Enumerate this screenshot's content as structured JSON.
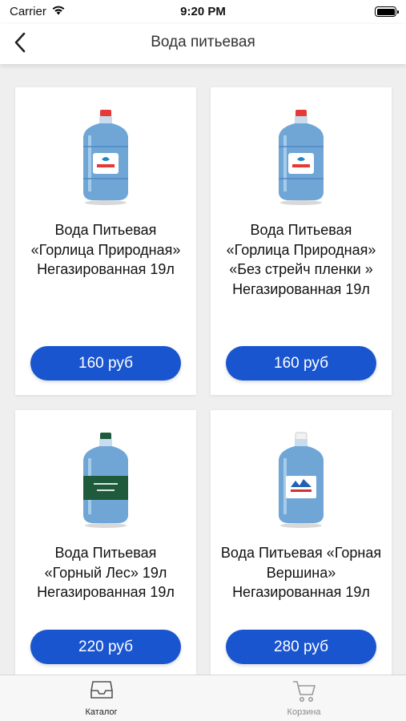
{
  "status": {
    "carrier": "Carrier",
    "time": "9:20 PM"
  },
  "nav": {
    "title": "Вода питьевая"
  },
  "products": [
    {
      "name": "Вода Питьевая «Горлица Природная» Негазированная 19л",
      "price": "160 руб",
      "label_color": "#ffffff",
      "cap_color": "#e53935"
    },
    {
      "name": "Вода Питьевая «Горлица Природная» «Без стрейч пленки » Негазированная 19л",
      "price": "160 руб",
      "label_color": "#ffffff",
      "cap_color": "#e53935"
    },
    {
      "name": "Вода Питьевая «Горный Лес» 19л Негазированная 19л",
      "price": "220 руб",
      "label_color": "#1f5a3c",
      "cap_color": "#1f5a3c"
    },
    {
      "name": "Вода Питьевая «Горная Вершина» Негазированная 19л",
      "price": "280 руб",
      "label_color": "#ffffff",
      "cap_color": "#f2f2f2"
    }
  ],
  "tabs": [
    {
      "label": "Каталог",
      "icon": "tray-icon",
      "active": true
    },
    {
      "label": "Корзина",
      "icon": "cart-icon",
      "active": false
    }
  ],
  "colors": {
    "accent": "#1a55d0",
    "background": "#efefef"
  }
}
